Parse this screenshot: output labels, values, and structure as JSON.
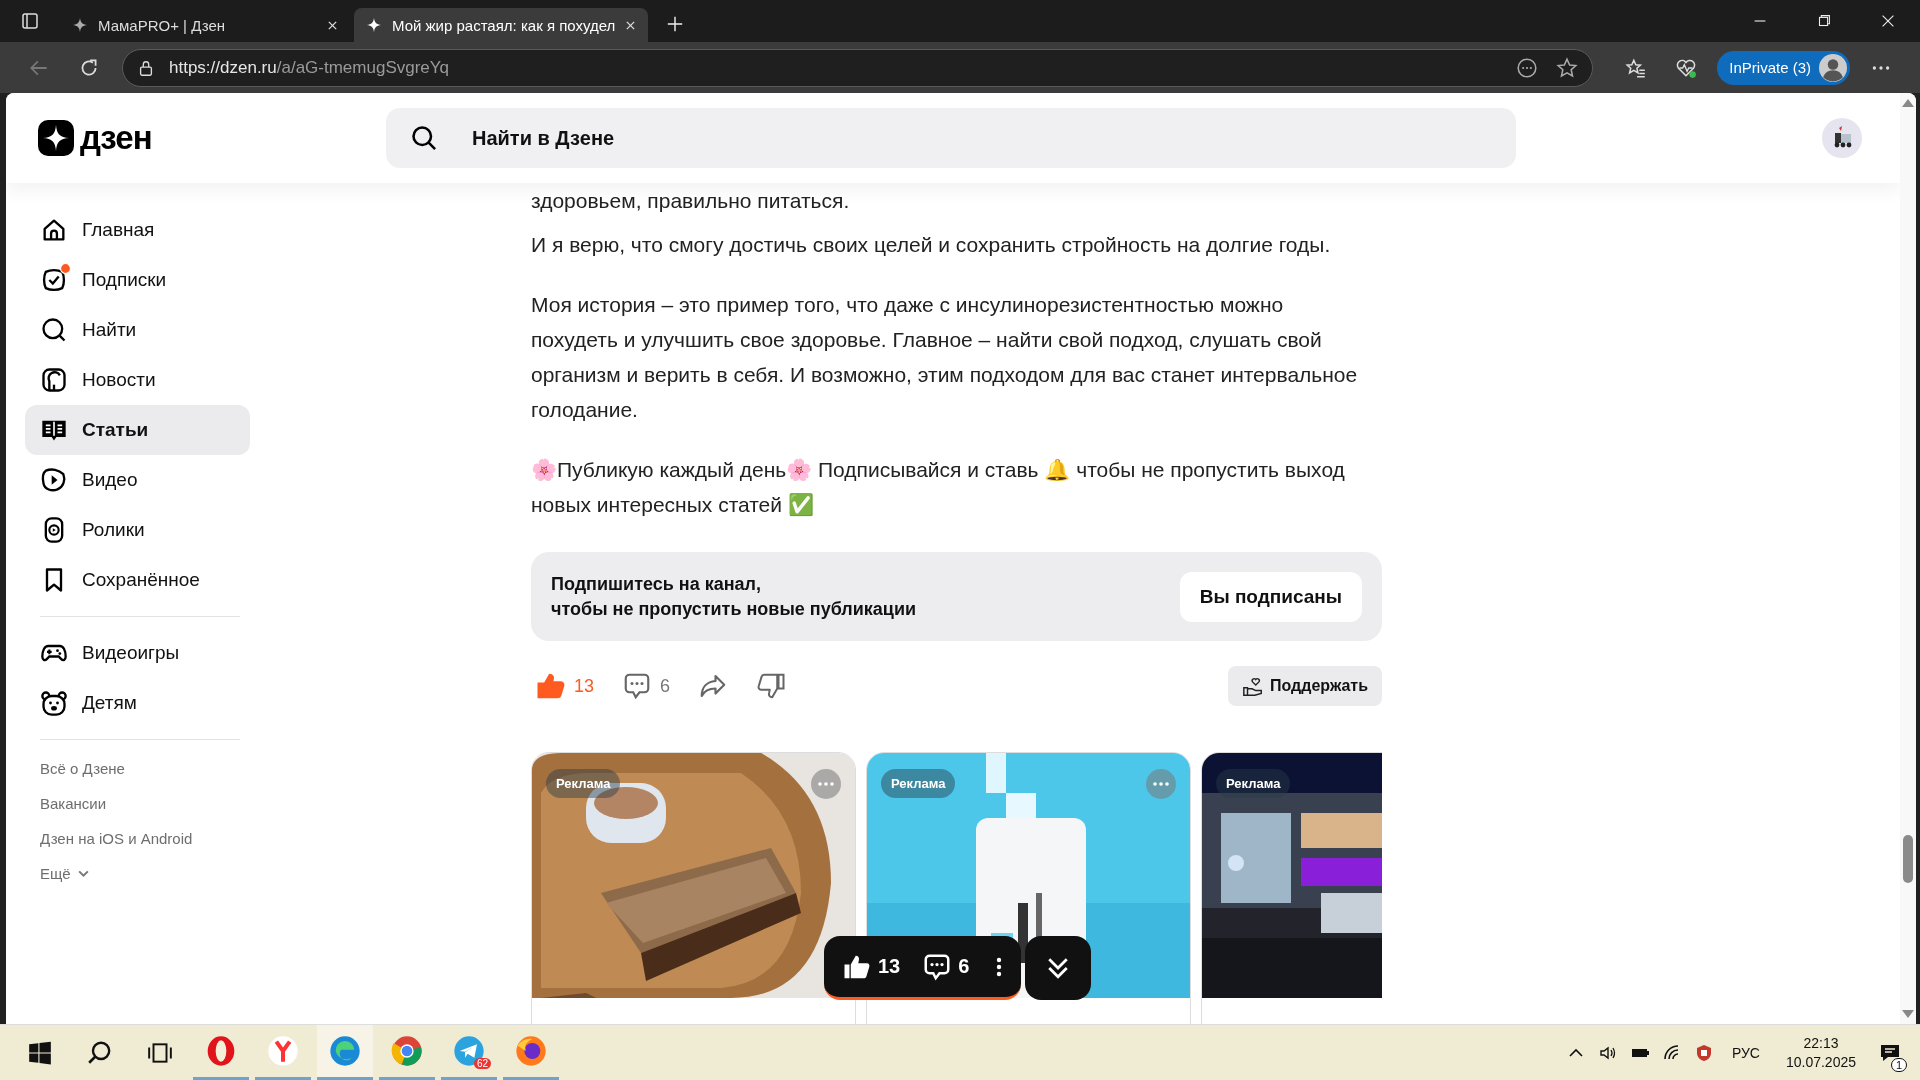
{
  "browser": {
    "tabs": [
      {
        "title": "МамаPRO+ | Дзен",
        "selected": false
      },
      {
        "title": "Мой жир растаял: как я похудел",
        "selected": true
      }
    ],
    "url_host": "https://dzen.ru",
    "url_path": "/a/aG-tmemugSvgreYq",
    "profile": "InPrivate (3)"
  },
  "header": {
    "logo": "дзен",
    "search": {
      "placeholder": "Найти в Дзене"
    }
  },
  "sidebar": {
    "items": [
      {
        "label": "Главная",
        "selected": false,
        "notification": false
      },
      {
        "label": "Подписки",
        "selected": false,
        "notification": true
      },
      {
        "label": "Найти",
        "selected": false,
        "notification": false
      },
      {
        "label": "Новости",
        "selected": false,
        "notification": false
      },
      {
        "label": "Статьи",
        "selected": true,
        "notification": false
      },
      {
        "label": "Видео",
        "selected": false,
        "notification": false
      },
      {
        "label": "Ролики",
        "selected": false,
        "notification": false
      },
      {
        "label": "Сохранённое",
        "selected": false,
        "notification": false
      }
    ],
    "extra_items": [
      {
        "label": "Видеоигры",
        "selected": false
      },
      {
        "label": "Детям",
        "selected": false
      }
    ],
    "footer_links": [
      "Всё о Дзене",
      "Вакансии",
      "Дзен на iOS и Android"
    ],
    "more": "Ещё"
  },
  "article": {
    "paragraphs": [
      "здоровьем, правильно питаться.",
      "И я верю, что смогу достичь своих целей и сохранить стройность на долгие годы.",
      "Моя история – это пример того, что даже с инсулинорезистентностью можно похудеть и улучшить свое здоровье. Главное – найти свой подход, слушать свой организм и верить в себя. И возможно, этим подходом для вас станет интервальное голодание.",
      "🌸Публикую каждый день🌸 Подписывайся и ставь 🔔 чтобы не пропустить выход новых интересных статей ✅"
    ]
  },
  "subscribe": {
    "text": "Подпишитесь на канал,\nчтобы не пропустить новые публикации",
    "button": "Вы подписаны"
  },
  "actions": {
    "likes": "13",
    "liked": true,
    "comments": "6",
    "support": "Поддержать"
  },
  "ads": [
    {
      "badge": "Реклама"
    },
    {
      "badge": "Реклама"
    },
    {
      "badge": "Реклама"
    }
  ],
  "floating_bar": {
    "likes": "13",
    "comments": "6"
  },
  "taskbar": {
    "telegram_badge": "62",
    "language": "РУС",
    "time": "22:13",
    "date": "10.07.2025",
    "notifications": "1"
  }
}
